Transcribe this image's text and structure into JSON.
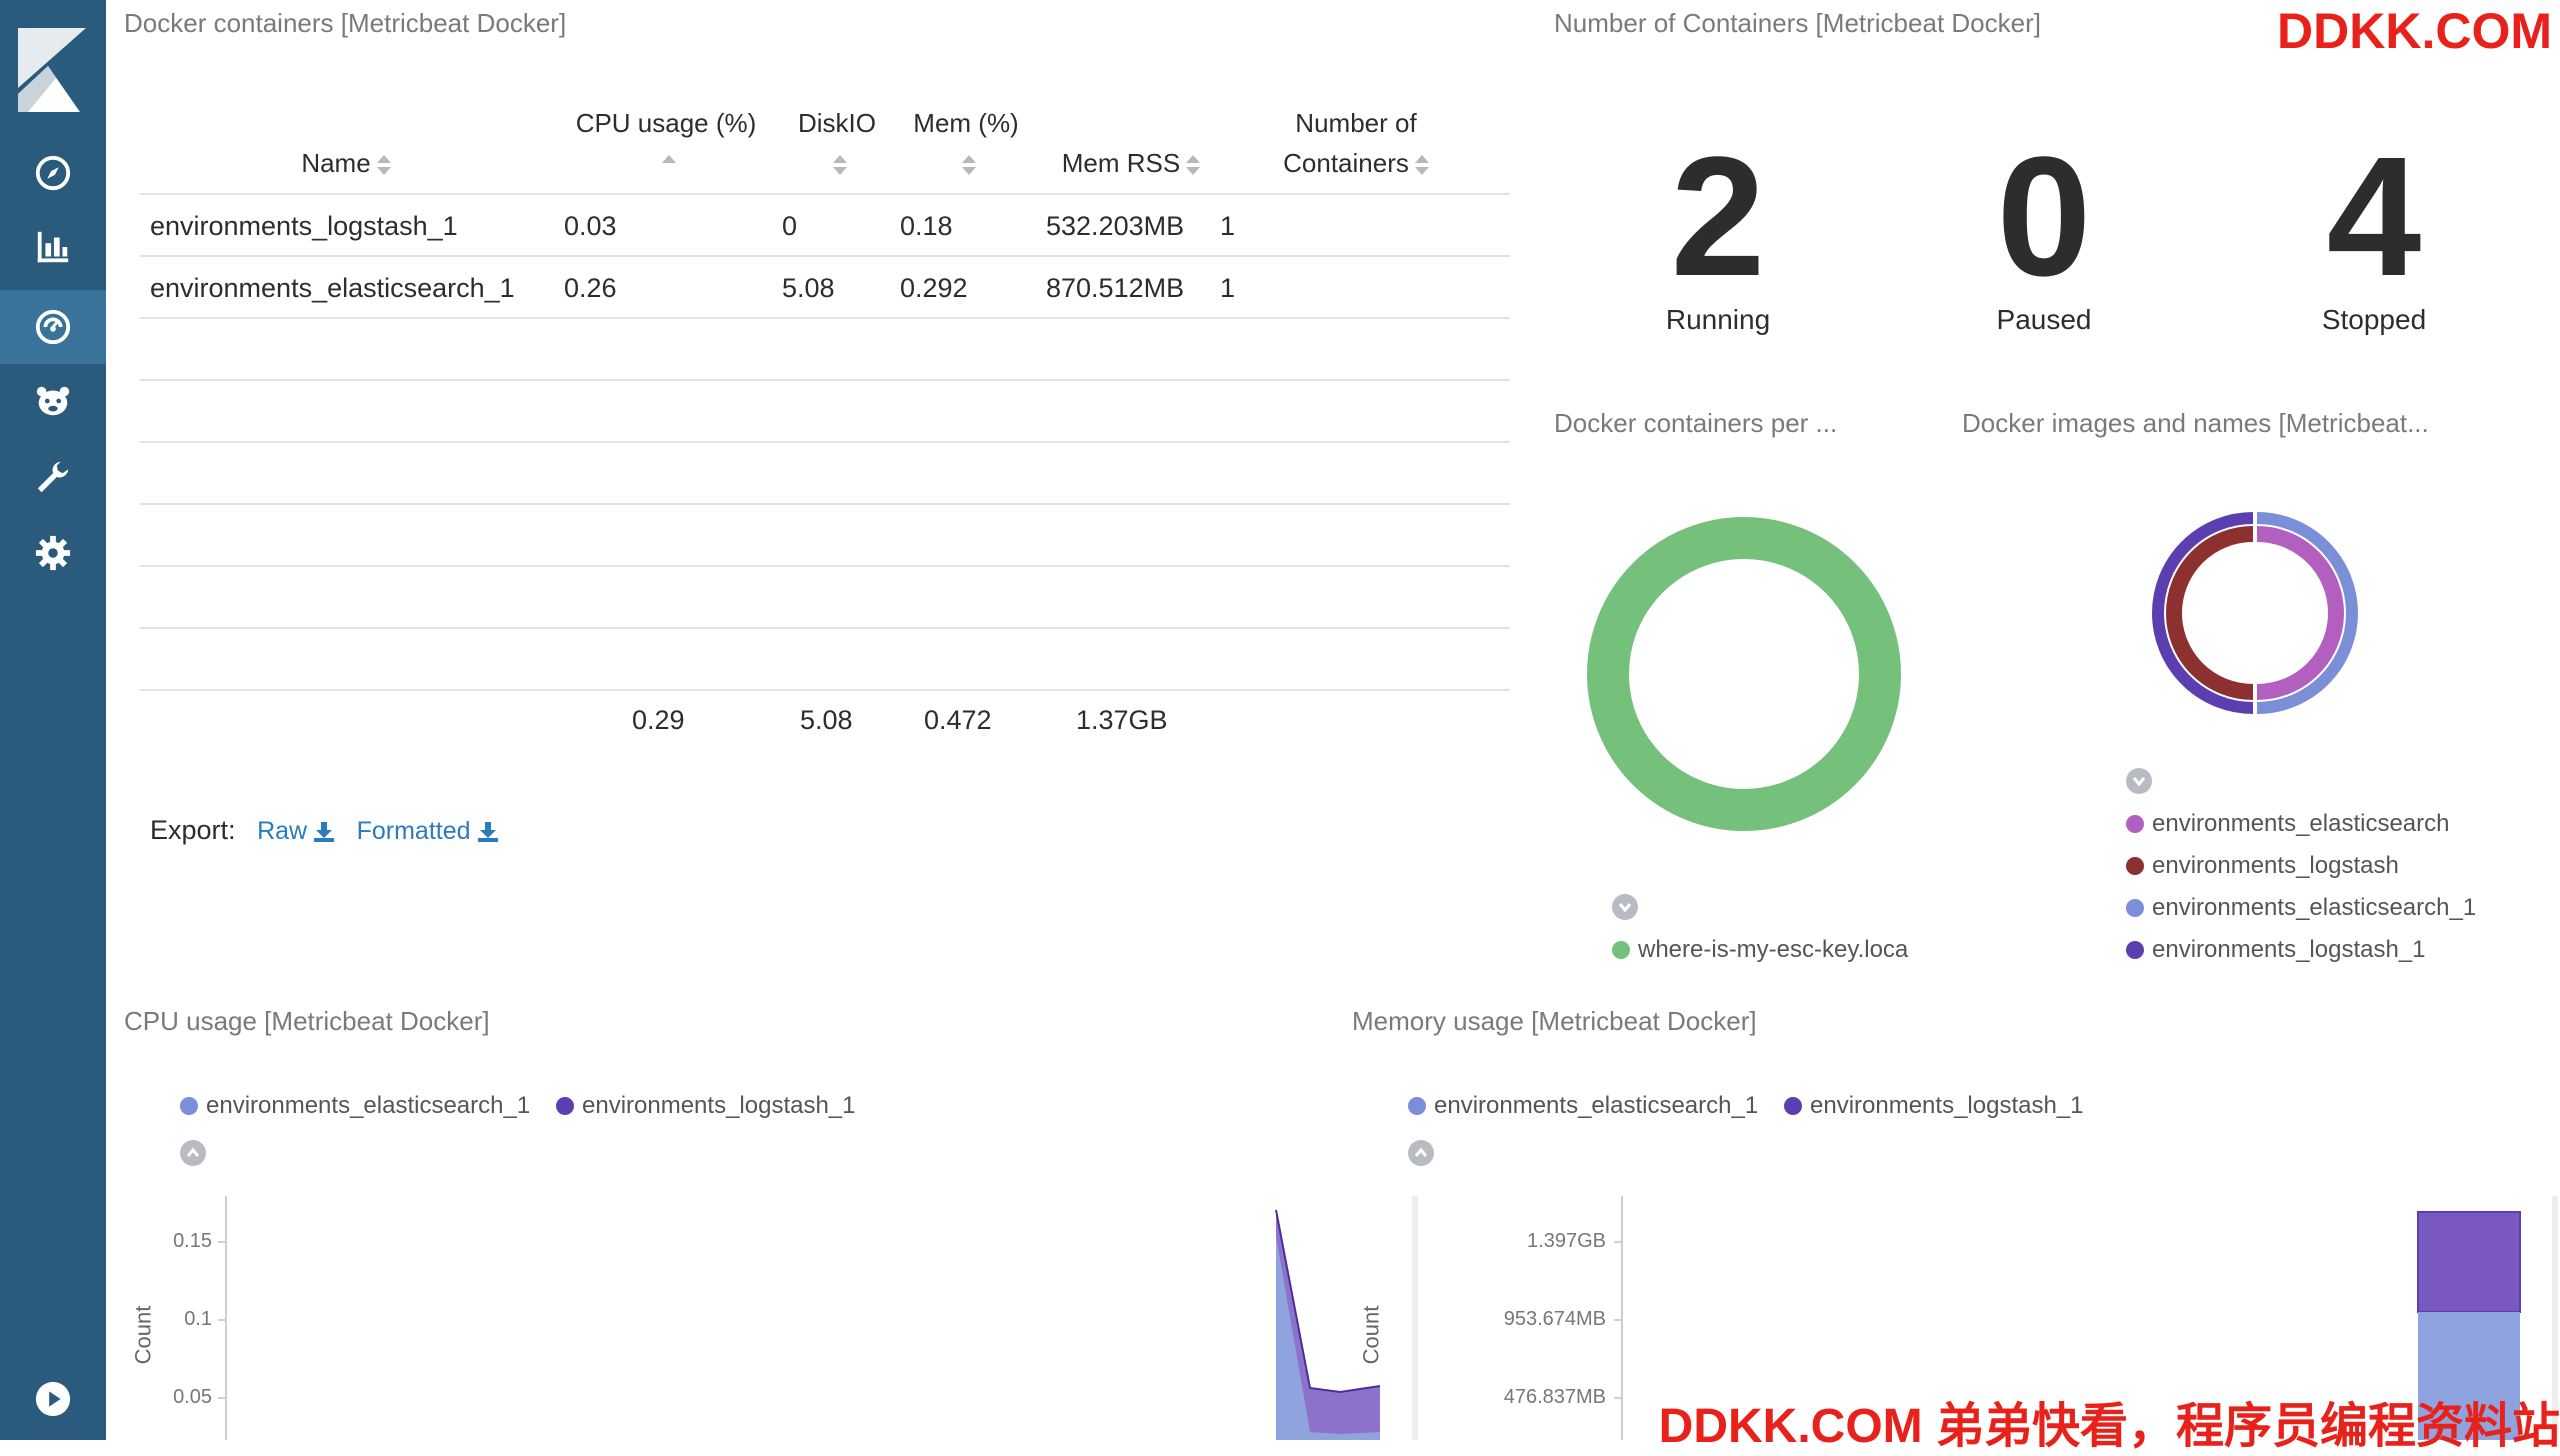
{
  "sidebar": {
    "logo_icon": "kibana-logo-icon",
    "items": [
      {
        "name": "discover",
        "icon": "compass-icon"
      },
      {
        "name": "visualize",
        "icon": "bar-chart-icon"
      },
      {
        "name": "dashboard",
        "icon": "dashboard-icon",
        "active": true
      },
      {
        "name": "timelion",
        "icon": "bear-icon"
      },
      {
        "name": "dev-tools",
        "icon": "wrench-icon"
      },
      {
        "name": "management",
        "icon": "gear-icon"
      }
    ],
    "bottom_icon": "play-icon"
  },
  "table_panel": {
    "title": "Docker containers [Metricbeat Docker]",
    "headers": {
      "name": "Name",
      "cpu": "CPU usage (%)",
      "diskio": "DiskIO",
      "mem": "Mem (%)",
      "memrss": "Mem RSS",
      "count_line1": "Number of",
      "count_line2": "Containers"
    },
    "rows": [
      {
        "name": "environments_logstash_1",
        "cpu": "0.03",
        "diskio": "0",
        "mem": "0.18",
        "memrss": "532.203MB",
        "count": "1"
      },
      {
        "name": "environments_elasticsearch_1",
        "cpu": "0.26",
        "diskio": "5.08",
        "mem": "0.292",
        "memrss": "870.512MB",
        "count": "1"
      }
    ],
    "totals": {
      "cpu": "0.29",
      "diskio": "5.08",
      "mem": "0.472",
      "memrss": "1.37GB"
    },
    "export_label": "Export:",
    "export_raw": "Raw",
    "export_formatted": "Formatted"
  },
  "count_panel": {
    "title": "Number of Containers [Metricbeat Docker]",
    "metrics": [
      {
        "value": "2",
        "label": "Running"
      },
      {
        "value": "0",
        "label": "Paused"
      },
      {
        "value": "4",
        "label": "Stopped"
      }
    ]
  },
  "host_panel": {
    "title": "Docker containers per ...",
    "legend": [
      {
        "label": "where-is-my-esc-key.loca",
        "color": "#75c07b"
      }
    ]
  },
  "images_panel": {
    "title": "Docker images and names [Metricbeat...",
    "legend": [
      {
        "label": "environments_elasticsearch",
        "color": "#b25fc0"
      },
      {
        "label": "environments_logstash",
        "color": "#8c3030"
      },
      {
        "label": "environments_elasticsearch_1",
        "color": "#7b8fd8"
      },
      {
        "label": "environments_logstash_1",
        "color": "#5b3fb0"
      }
    ]
  },
  "cpu_panel": {
    "title": "CPU usage [Metricbeat Docker]",
    "legend": [
      {
        "label": "environments_elasticsearch_1",
        "color": "#7b8fd8"
      },
      {
        "label": "environments_logstash_1",
        "color": "#5b3fb0"
      }
    ],
    "ylabel": "Count",
    "ticks": [
      "0.15",
      "0.1",
      "0.05"
    ]
  },
  "mem_panel": {
    "title": "Memory usage [Metricbeat Docker]",
    "legend": [
      {
        "label": "environments_elasticsearch_1",
        "color": "#7b8fd8"
      },
      {
        "label": "environments_logstash_1",
        "color": "#5b3fb0"
      }
    ],
    "ylabel": "Count",
    "ticks": [
      "1.397GB",
      "953.674MB",
      "476.837MB"
    ]
  },
  "watermarks": {
    "top": "DDKK.COM",
    "bottom": "DDKK.COM 弟弟快看，程序员编程资料站"
  }
}
